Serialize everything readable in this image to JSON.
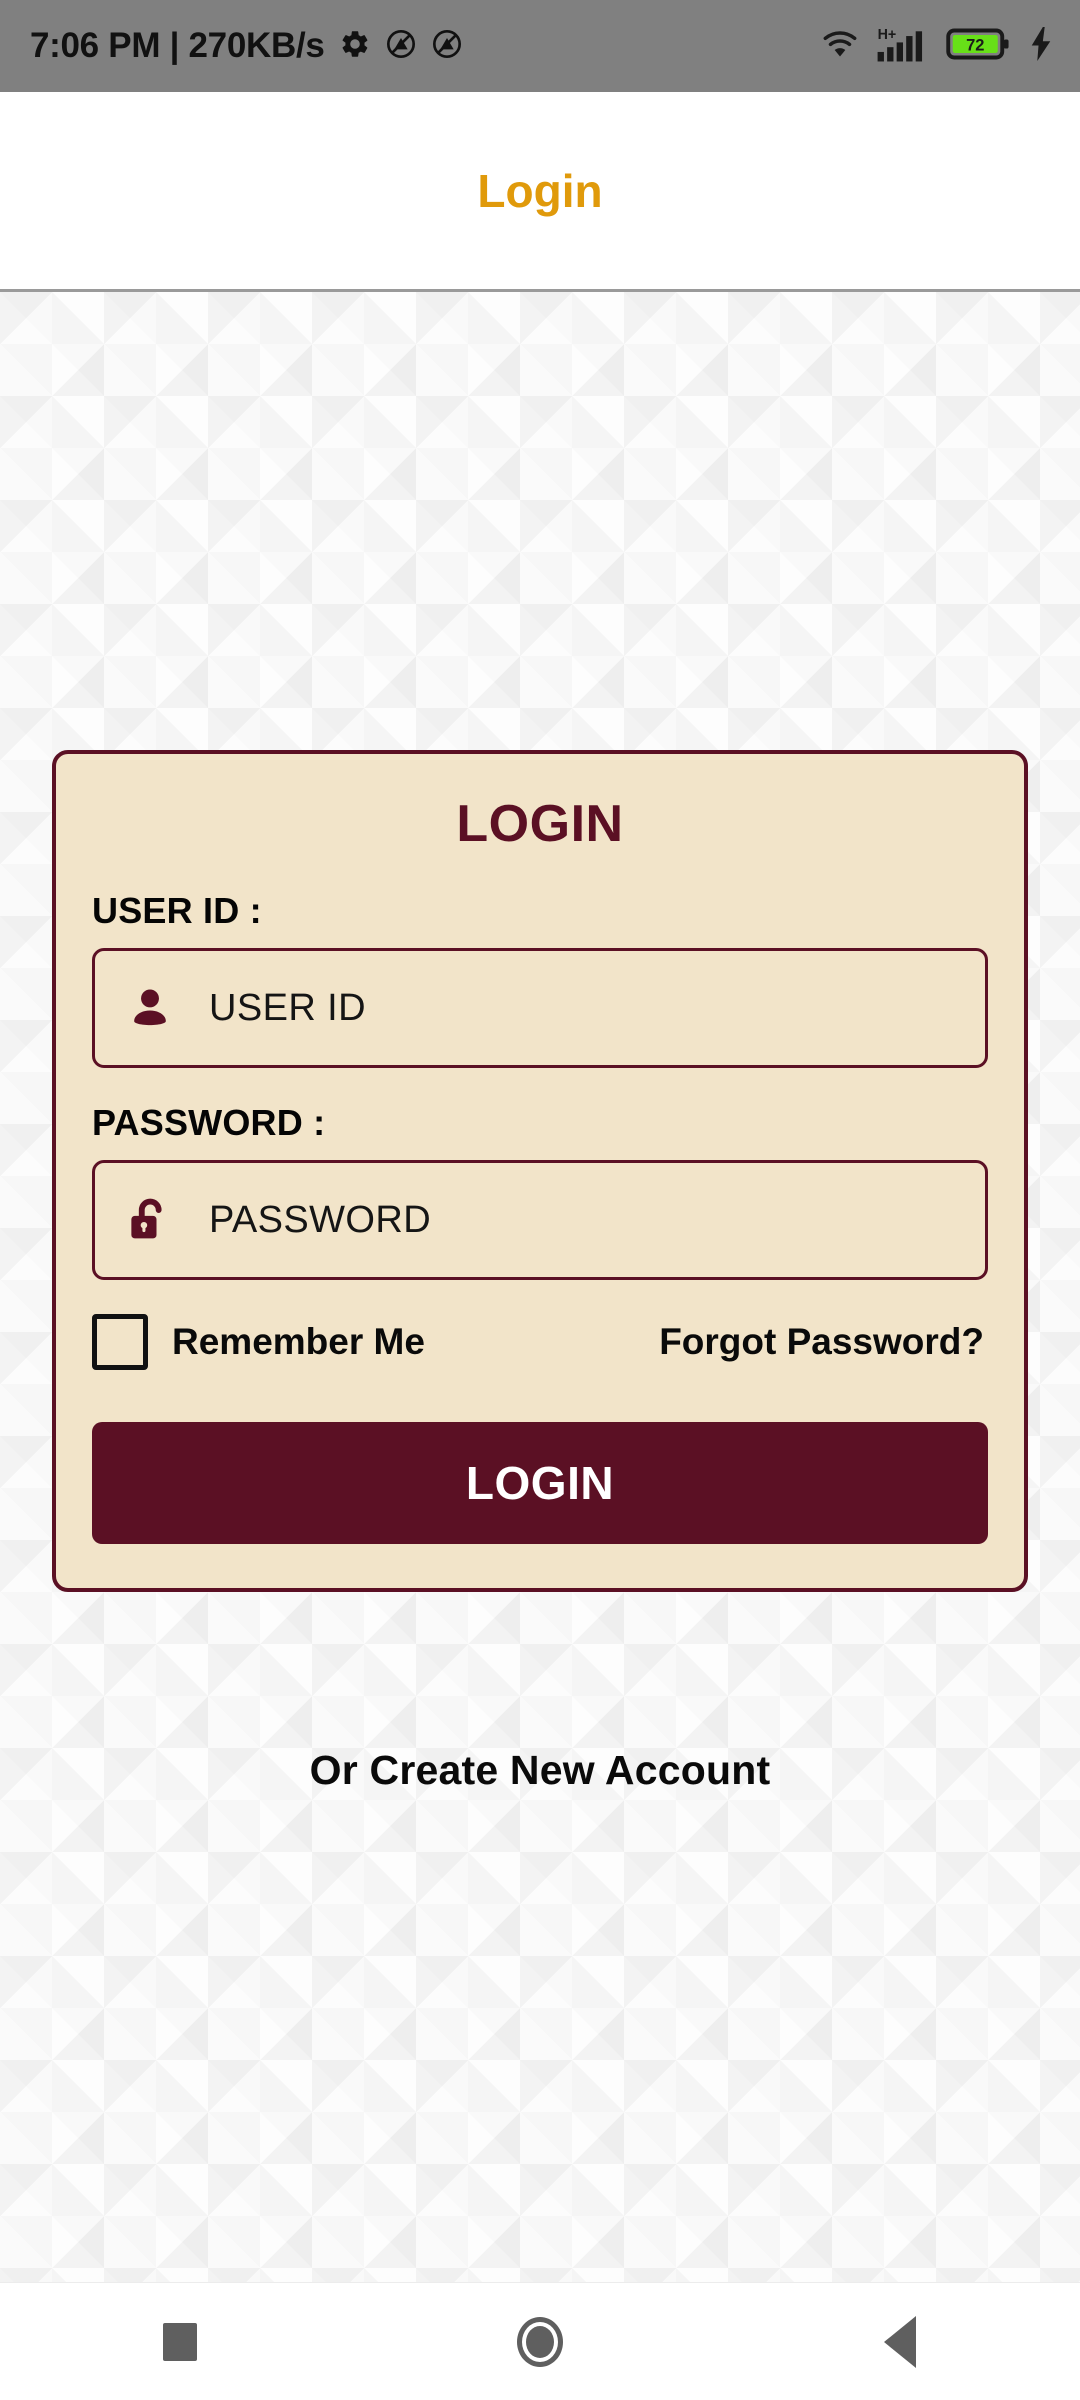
{
  "status_bar": {
    "time": "7:06 PM",
    "separator": "|",
    "network_speed": "270KB/s",
    "time_and_speed": "7:06 PM | 270KB/s",
    "icons": [
      "gear-icon",
      "do-not-disturb-icon",
      "do-not-disturb-icon",
      "wifi-icon",
      "signal-icon",
      "battery-icon"
    ],
    "network_type": "H+",
    "battery_level": "72",
    "charging": true,
    "background_color": "#808080"
  },
  "app_bar": {
    "title": "Login",
    "title_color": "#E09A0B",
    "background_color": "#FFFFFF"
  },
  "card": {
    "title": "LOGIN",
    "title_color": "#5B1024",
    "background_color": "#F2E4C9",
    "border_color": "#5B1024",
    "user_id": {
      "label": "USER ID :",
      "placeholder": "USER ID",
      "value": "",
      "icon": "person-icon"
    },
    "password": {
      "label": "PASSWORD :",
      "placeholder": "PASSWORD",
      "value": "",
      "icon": "unlocked-padlock-icon"
    },
    "remember_me": {
      "label": "Remember Me",
      "checked": false
    },
    "forgot_password": "Forgot Password?",
    "login_button": {
      "label": "LOGIN",
      "background_color": "#5B1024",
      "text_color": "#FFFFFF"
    }
  },
  "footer": {
    "create_account": "Or Create New Account"
  },
  "nav_bar": {
    "recents": "recents-square-icon",
    "home": "home-circle-icon",
    "back": "back-triangle-icon",
    "icon_color": "#5F5F5F"
  }
}
